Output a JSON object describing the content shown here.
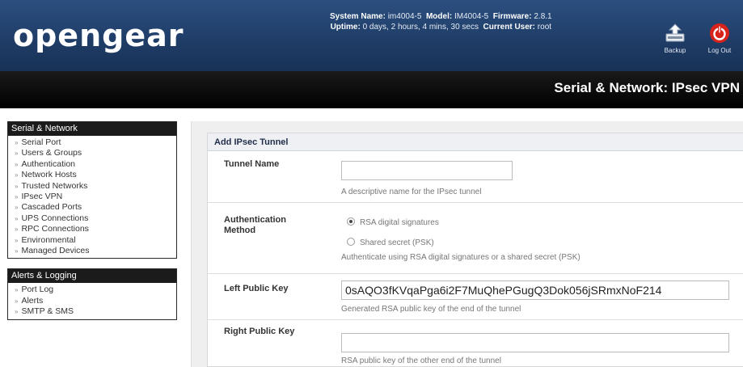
{
  "header": {
    "logo": "opengear",
    "sysinfo": {
      "line1_label1": "System Name:",
      "line1_value1": "im4004-5",
      "line1_label2": "Model:",
      "line1_value2": "IM4004-5",
      "line1_label3": "Firmware:",
      "line1_value3": "2.8.1",
      "line2_label1": "Uptime:",
      "line2_value1": "0 days, 2 hours, 4 mins, 30 secs",
      "line2_label2": "Current User:",
      "line2_value2": "root"
    },
    "backup_label": "Backup",
    "logout_label": "Log Out"
  },
  "titlebar": {
    "title": "Serial & Network: IPsec VPN"
  },
  "sidebar": {
    "groups": [
      {
        "title": "Serial & Network",
        "items": [
          "Serial Port",
          "Users & Groups",
          "Authentication",
          "Network Hosts",
          "Trusted Networks",
          "IPsec VPN",
          "Cascaded Ports",
          "UPS Connections",
          "RPC Connections",
          "Environmental",
          "Managed Devices"
        ]
      },
      {
        "title": "Alerts & Logging",
        "items": [
          "Port Log",
          "Alerts",
          "SMTP & SMS"
        ]
      }
    ]
  },
  "form": {
    "title": "Add IPsec Tunnel",
    "tunnel_name": {
      "label": "Tunnel Name",
      "value": "",
      "help": "A descriptive name for the IPsec tunnel"
    },
    "auth_method": {
      "label_line1": "Authentication",
      "label_line2": "Method",
      "option1": "RSA digital signatures",
      "option2": "Shared secret (PSK)",
      "selected": "RSA digital signatures",
      "help": "Authenticate using RSA digital signatures or a shared secret (PSK)"
    },
    "left_key": {
      "label": "Left Public Key",
      "value": "0sAQO3fKVqaPga6i2F7MuQhePGugQ3Dok056jSRmxNoF214",
      "help": "Generated RSA public key of the end of the tunnel"
    },
    "right_key": {
      "label": "Right Public Key",
      "value": "",
      "help": "RSA public key of the other end of the tunnel"
    }
  },
  "colors": {
    "header_blue": "#1f3c66",
    "titlebar_black": "#000000",
    "logout_red": "#d8221c"
  }
}
